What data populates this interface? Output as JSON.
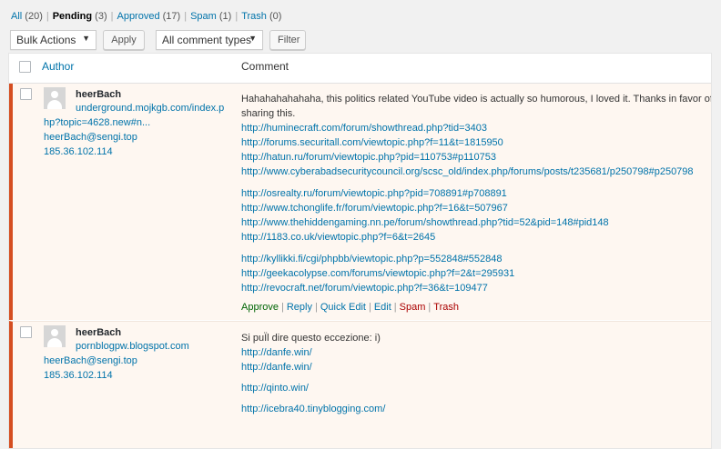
{
  "filters": [
    {
      "label": "All",
      "count": "(20)"
    },
    {
      "label": "Pending",
      "count": "(3)"
    },
    {
      "label": "Approved",
      "count": "(17)"
    },
    {
      "label": "Spam",
      "count": "(1)"
    },
    {
      "label": "Trash",
      "count": "(0)"
    }
  ],
  "toolbar": {
    "bulk_actions": "Bulk Actions",
    "apply": "Apply",
    "comment_types": "All comment types",
    "filter": "Filter"
  },
  "table": {
    "author_header": "Author",
    "comment_header": "Comment"
  },
  "comments": [
    {
      "author": "heerBach",
      "site_line1": "underground.mojkgb.com/index.p",
      "site_line2": "hp?topic=4628.new#n...",
      "email": "heerBach@sengi.top",
      "ip": "185.36.102.114",
      "text_line1": "Hahahahahahaha, this politics related YouTube video is actually so humorous, I loved it. Thanks in favor of",
      "text_line2": "sharing this.",
      "links": [
        "http://huminecraft.com/forum/showthread.php?tid=3403",
        "http://forums.securitall.com/viewtopic.php?f=11&t=1815950",
        "http://hatun.ru/forum/viewtopic.php?pid=110753#p110753",
        "http://www.cyberabadsecuritycouncil.org/scsc_old/index.php/forums/posts/t235681/p250798#p250798",
        "http://osrealty.ru/forum/viewtopic.php?pid=708891#p708891",
        "http://www.tchonglife.fr/forum/viewtopic.php?f=16&t=507967",
        "http://www.thehiddengaming.nn.pe/forum/showthread.php?tid=52&pid=148#pid148",
        "http://1183.co.uk/viewtopic.php?f=6&t=2645",
        "http://kyllikki.fi/cgi/phpbb/viewtopic.php?p=552848#552848",
        "http://geekacolypse.com/forums/viewtopic.php?f=2&t=295931",
        "http://revocraft.net/forum/viewtopic.php?f=36&t=109477"
      ],
      "actions": {
        "approve": "Approve",
        "reply": "Reply",
        "quick_edit": "Quick Edit",
        "edit": "Edit",
        "spam": "Spam",
        "trash": "Trash"
      }
    },
    {
      "author": "heerBach",
      "site": "pornblogpw.blogspot.com",
      "email": "heerBach@sengi.top",
      "ip": "185.36.102.114",
      "text_line1": "Si puÏl dire questo eccezione: i)",
      "links": [
        "http://danfe.win/",
        "http://danfe.win/",
        "http://qinto.win/",
        "http://icebra40.tinyblogging.com/"
      ]
    }
  ]
}
